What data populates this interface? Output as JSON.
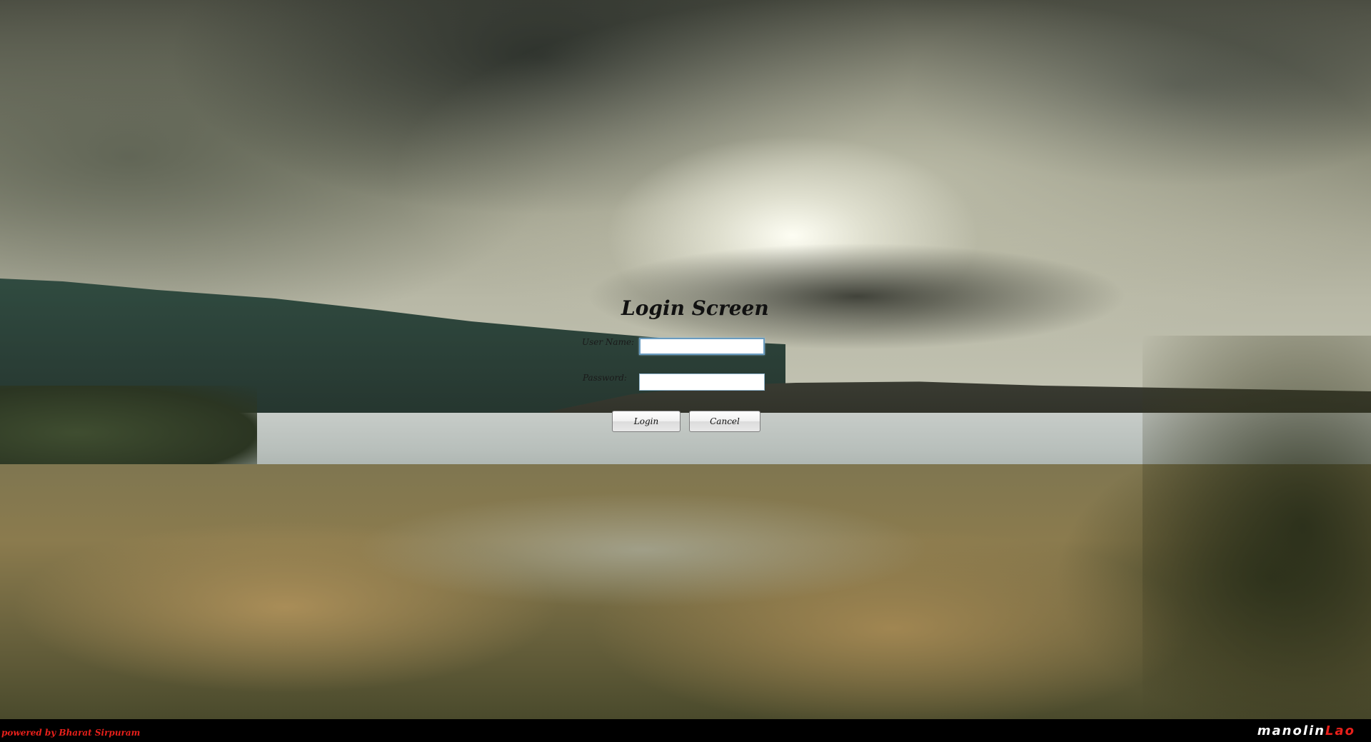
{
  "login": {
    "title": "Login Screen",
    "username_label": "User Name:",
    "username_value": "",
    "password_label": "Password:",
    "password_value": "",
    "login_button": "Login",
    "cancel_button": "Cancel"
  },
  "footer": {
    "powered_by": "powered by Bharat Sirpuram",
    "brand_part1": "manolin",
    "brand_part2": "Lao"
  },
  "colors": {
    "footer_background": "#000000",
    "footer_text_accent": "#e8201b",
    "input_border_focus": "#6a9cc0"
  }
}
